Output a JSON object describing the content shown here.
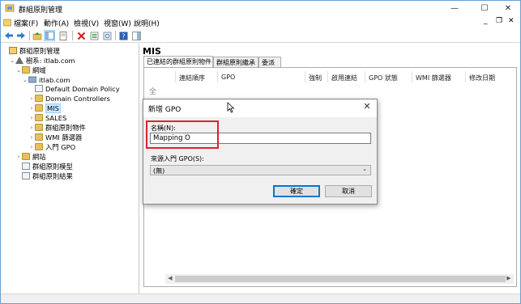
{
  "window": {
    "title": "群組原則管理"
  },
  "window_controls": {
    "minimize": "—",
    "maximize": "☐",
    "close": "✕"
  },
  "menubar": {
    "items": [
      "檔案(F)",
      "動作(A)",
      "檢視(V)",
      "視窗(W)",
      "說明(H)"
    ],
    "window_min": "_",
    "window_restore": "❐",
    "window_close": "✕"
  },
  "tree": {
    "root": "群組原則管理",
    "forest": "樹系: itlab.com",
    "domains": "網域",
    "domain": "itlab.com",
    "items": [
      "Default Domain Policy",
      "Domain Controllers",
      "MIS",
      "SALES",
      "群組原則物件",
      "WMI 篩選器",
      "入門 GPO"
    ],
    "sites": "網站",
    "modeling": "群組原則模型",
    "results": "群組原則結果"
  },
  "right": {
    "heading": "MIS",
    "tabs": [
      "已連結的群組原則物件",
      "群組原則繼承",
      "委派"
    ],
    "columns": [
      "連結順序",
      "GPO",
      "強制",
      "啟用連結",
      "GPO 狀態",
      "WMI 篩選器",
      "修改日期"
    ],
    "side_glyph": "全"
  },
  "dialog": {
    "title": "新增 GPO",
    "close": "✕",
    "name_label": "名稱(N):",
    "name_value": "Mapping O",
    "source_label": "來源入門 GPO(S):",
    "source_value": "(無)",
    "ok": "確定",
    "cancel": "取消"
  },
  "colors": {
    "highlight_box": "#d7262d",
    "selection": "#cce8ff",
    "accent": "#0078d7"
  }
}
